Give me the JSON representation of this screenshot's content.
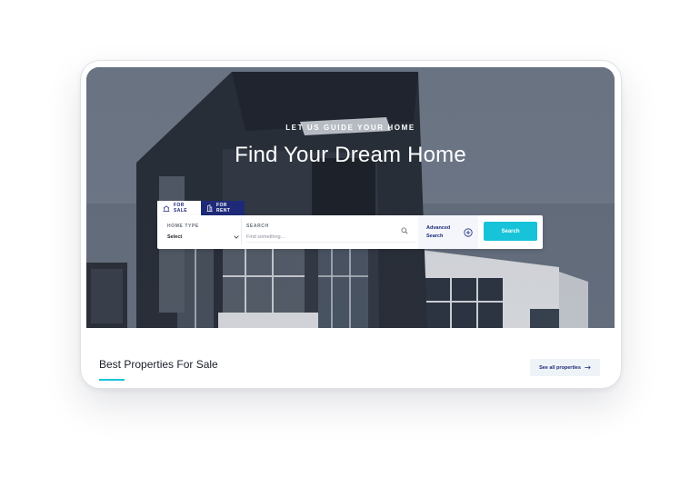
{
  "hero": {
    "eyebrow": "LET US GUIDE YOUR HOME",
    "title": "Find Your Dream Home",
    "image_icon": "modern-building-photo"
  },
  "tabs": [
    {
      "label": "FOR SALE",
      "icon": "house-icon",
      "active": true
    },
    {
      "label": "FOR RENT",
      "icon": "building-icon",
      "active": false
    }
  ],
  "search_form": {
    "home_type_label": "HOME TYPE",
    "home_type_value": "Select",
    "search_label": "SEARCH",
    "search_placeholder": "Find something...",
    "advanced_label": "Advanced Search",
    "search_button": "Search"
  },
  "section": {
    "title": "Best Properties For Sale",
    "see_all": "See all properties"
  },
  "colors": {
    "accent": "#17c3d9",
    "brand_navy": "#1e2a78",
    "background": "#ffffff"
  }
}
